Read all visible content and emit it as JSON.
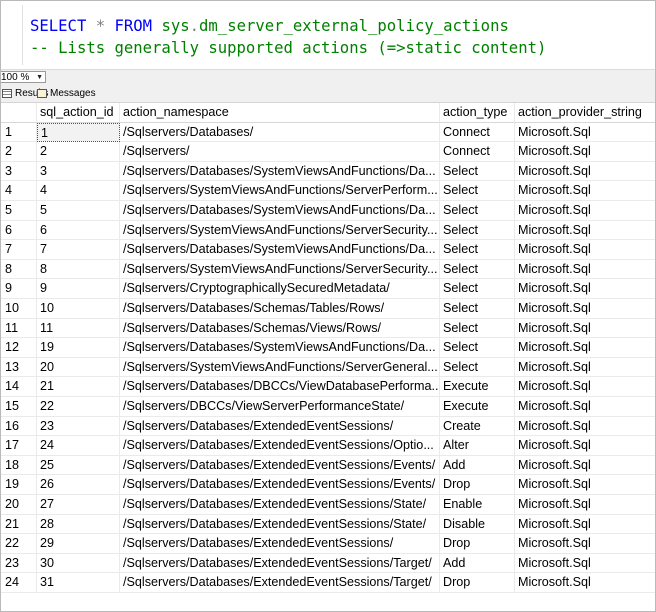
{
  "query": {
    "line1": {
      "select": "SELECT",
      "star": "*",
      "from": "FROM",
      "schema": "sys",
      "dot": ".",
      "object": "dm_server_external_policy_actions"
    },
    "line2": "-- Lists generally supported actions (=>static content)"
  },
  "zoom": {
    "value": "100 %"
  },
  "tabs": {
    "results": "Results",
    "messages": "Messages"
  },
  "grid": {
    "columns": [
      "sql_action_id",
      "action_namespace",
      "action_type",
      "action_provider_string"
    ],
    "rows": [
      {
        "rn": "1",
        "id": "1",
        "ns": "/Sqlservers/Databases/",
        "type": "Connect",
        "prov": "Microsoft.Sql"
      },
      {
        "rn": "2",
        "id": "2",
        "ns": "/Sqlservers/",
        "type": "Connect",
        "prov": "Microsoft.Sql"
      },
      {
        "rn": "3",
        "id": "3",
        "ns": "/Sqlservers/Databases/SystemViewsAndFunctions/Da...",
        "type": "Select",
        "prov": "Microsoft.Sql"
      },
      {
        "rn": "4",
        "id": "4",
        "ns": "/Sqlservers/SystemViewsAndFunctions/ServerPerform...",
        "type": "Select",
        "prov": "Microsoft.Sql"
      },
      {
        "rn": "5",
        "id": "5",
        "ns": "/Sqlservers/Databases/SystemViewsAndFunctions/Da...",
        "type": "Select",
        "prov": "Microsoft.Sql"
      },
      {
        "rn": "6",
        "id": "6",
        "ns": "/Sqlservers/SystemViewsAndFunctions/ServerSecurity...",
        "type": "Select",
        "prov": "Microsoft.Sql"
      },
      {
        "rn": "7",
        "id": "7",
        "ns": "/Sqlservers/Databases/SystemViewsAndFunctions/Da...",
        "type": "Select",
        "prov": "Microsoft.Sql"
      },
      {
        "rn": "8",
        "id": "8",
        "ns": "/Sqlservers/SystemViewsAndFunctions/ServerSecurity...",
        "type": "Select",
        "prov": "Microsoft.Sql"
      },
      {
        "rn": "9",
        "id": "9",
        "ns": "/Sqlservers/CryptographicallySecuredMetadata/",
        "type": "Select",
        "prov": "Microsoft.Sql"
      },
      {
        "rn": "10",
        "id": "10",
        "ns": "/Sqlservers/Databases/Schemas/Tables/Rows/",
        "type": "Select",
        "prov": "Microsoft.Sql"
      },
      {
        "rn": "11",
        "id": "11",
        "ns": "/Sqlservers/Databases/Schemas/Views/Rows/",
        "type": "Select",
        "prov": "Microsoft.Sql"
      },
      {
        "rn": "12",
        "id": "19",
        "ns": "/Sqlservers/Databases/SystemViewsAndFunctions/Da...",
        "type": "Select",
        "prov": "Microsoft.Sql"
      },
      {
        "rn": "13",
        "id": "20",
        "ns": "/Sqlservers/SystemViewsAndFunctions/ServerGeneral...",
        "type": "Select",
        "prov": "Microsoft.Sql"
      },
      {
        "rn": "14",
        "id": "21",
        "ns": "/Sqlservers/Databases/DBCCs/ViewDatabasePerforma...",
        "type": "Execute",
        "prov": "Microsoft.Sql"
      },
      {
        "rn": "15",
        "id": "22",
        "ns": "/Sqlservers/DBCCs/ViewServerPerformanceState/",
        "type": "Execute",
        "prov": "Microsoft.Sql"
      },
      {
        "rn": "16",
        "id": "23",
        "ns": "/Sqlservers/Databases/ExtendedEventSessions/",
        "type": "Create",
        "prov": "Microsoft.Sql"
      },
      {
        "rn": "17",
        "id": "24",
        "ns": "/Sqlservers/Databases/ExtendedEventSessions/Optio...",
        "type": "Alter",
        "prov": "Microsoft.Sql"
      },
      {
        "rn": "18",
        "id": "25",
        "ns": "/Sqlservers/Databases/ExtendedEventSessions/Events/",
        "type": "Add",
        "prov": "Microsoft.Sql"
      },
      {
        "rn": "19",
        "id": "26",
        "ns": "/Sqlservers/Databases/ExtendedEventSessions/Events/",
        "type": "Drop",
        "prov": "Microsoft.Sql"
      },
      {
        "rn": "20",
        "id": "27",
        "ns": "/Sqlservers/Databases/ExtendedEventSessions/State/",
        "type": "Enable",
        "prov": "Microsoft.Sql"
      },
      {
        "rn": "21",
        "id": "28",
        "ns": "/Sqlservers/Databases/ExtendedEventSessions/State/",
        "type": "Disable",
        "prov": "Microsoft.Sql"
      },
      {
        "rn": "22",
        "id": "29",
        "ns": "/Sqlservers/Databases/ExtendedEventSessions/",
        "type": "Drop",
        "prov": "Microsoft.Sql"
      },
      {
        "rn": "23",
        "id": "30",
        "ns": "/Sqlservers/Databases/ExtendedEventSessions/Target/",
        "type": "Add",
        "prov": "Microsoft.Sql"
      },
      {
        "rn": "24",
        "id": "31",
        "ns": "/Sqlservers/Databases/ExtendedEventSessions/Target/",
        "type": "Drop",
        "prov": "Microsoft.Sql"
      }
    ]
  },
  "colors": {
    "keyword": "#0000ff",
    "system": "#008000",
    "comment": "#008000",
    "operator": "#808080"
  }
}
